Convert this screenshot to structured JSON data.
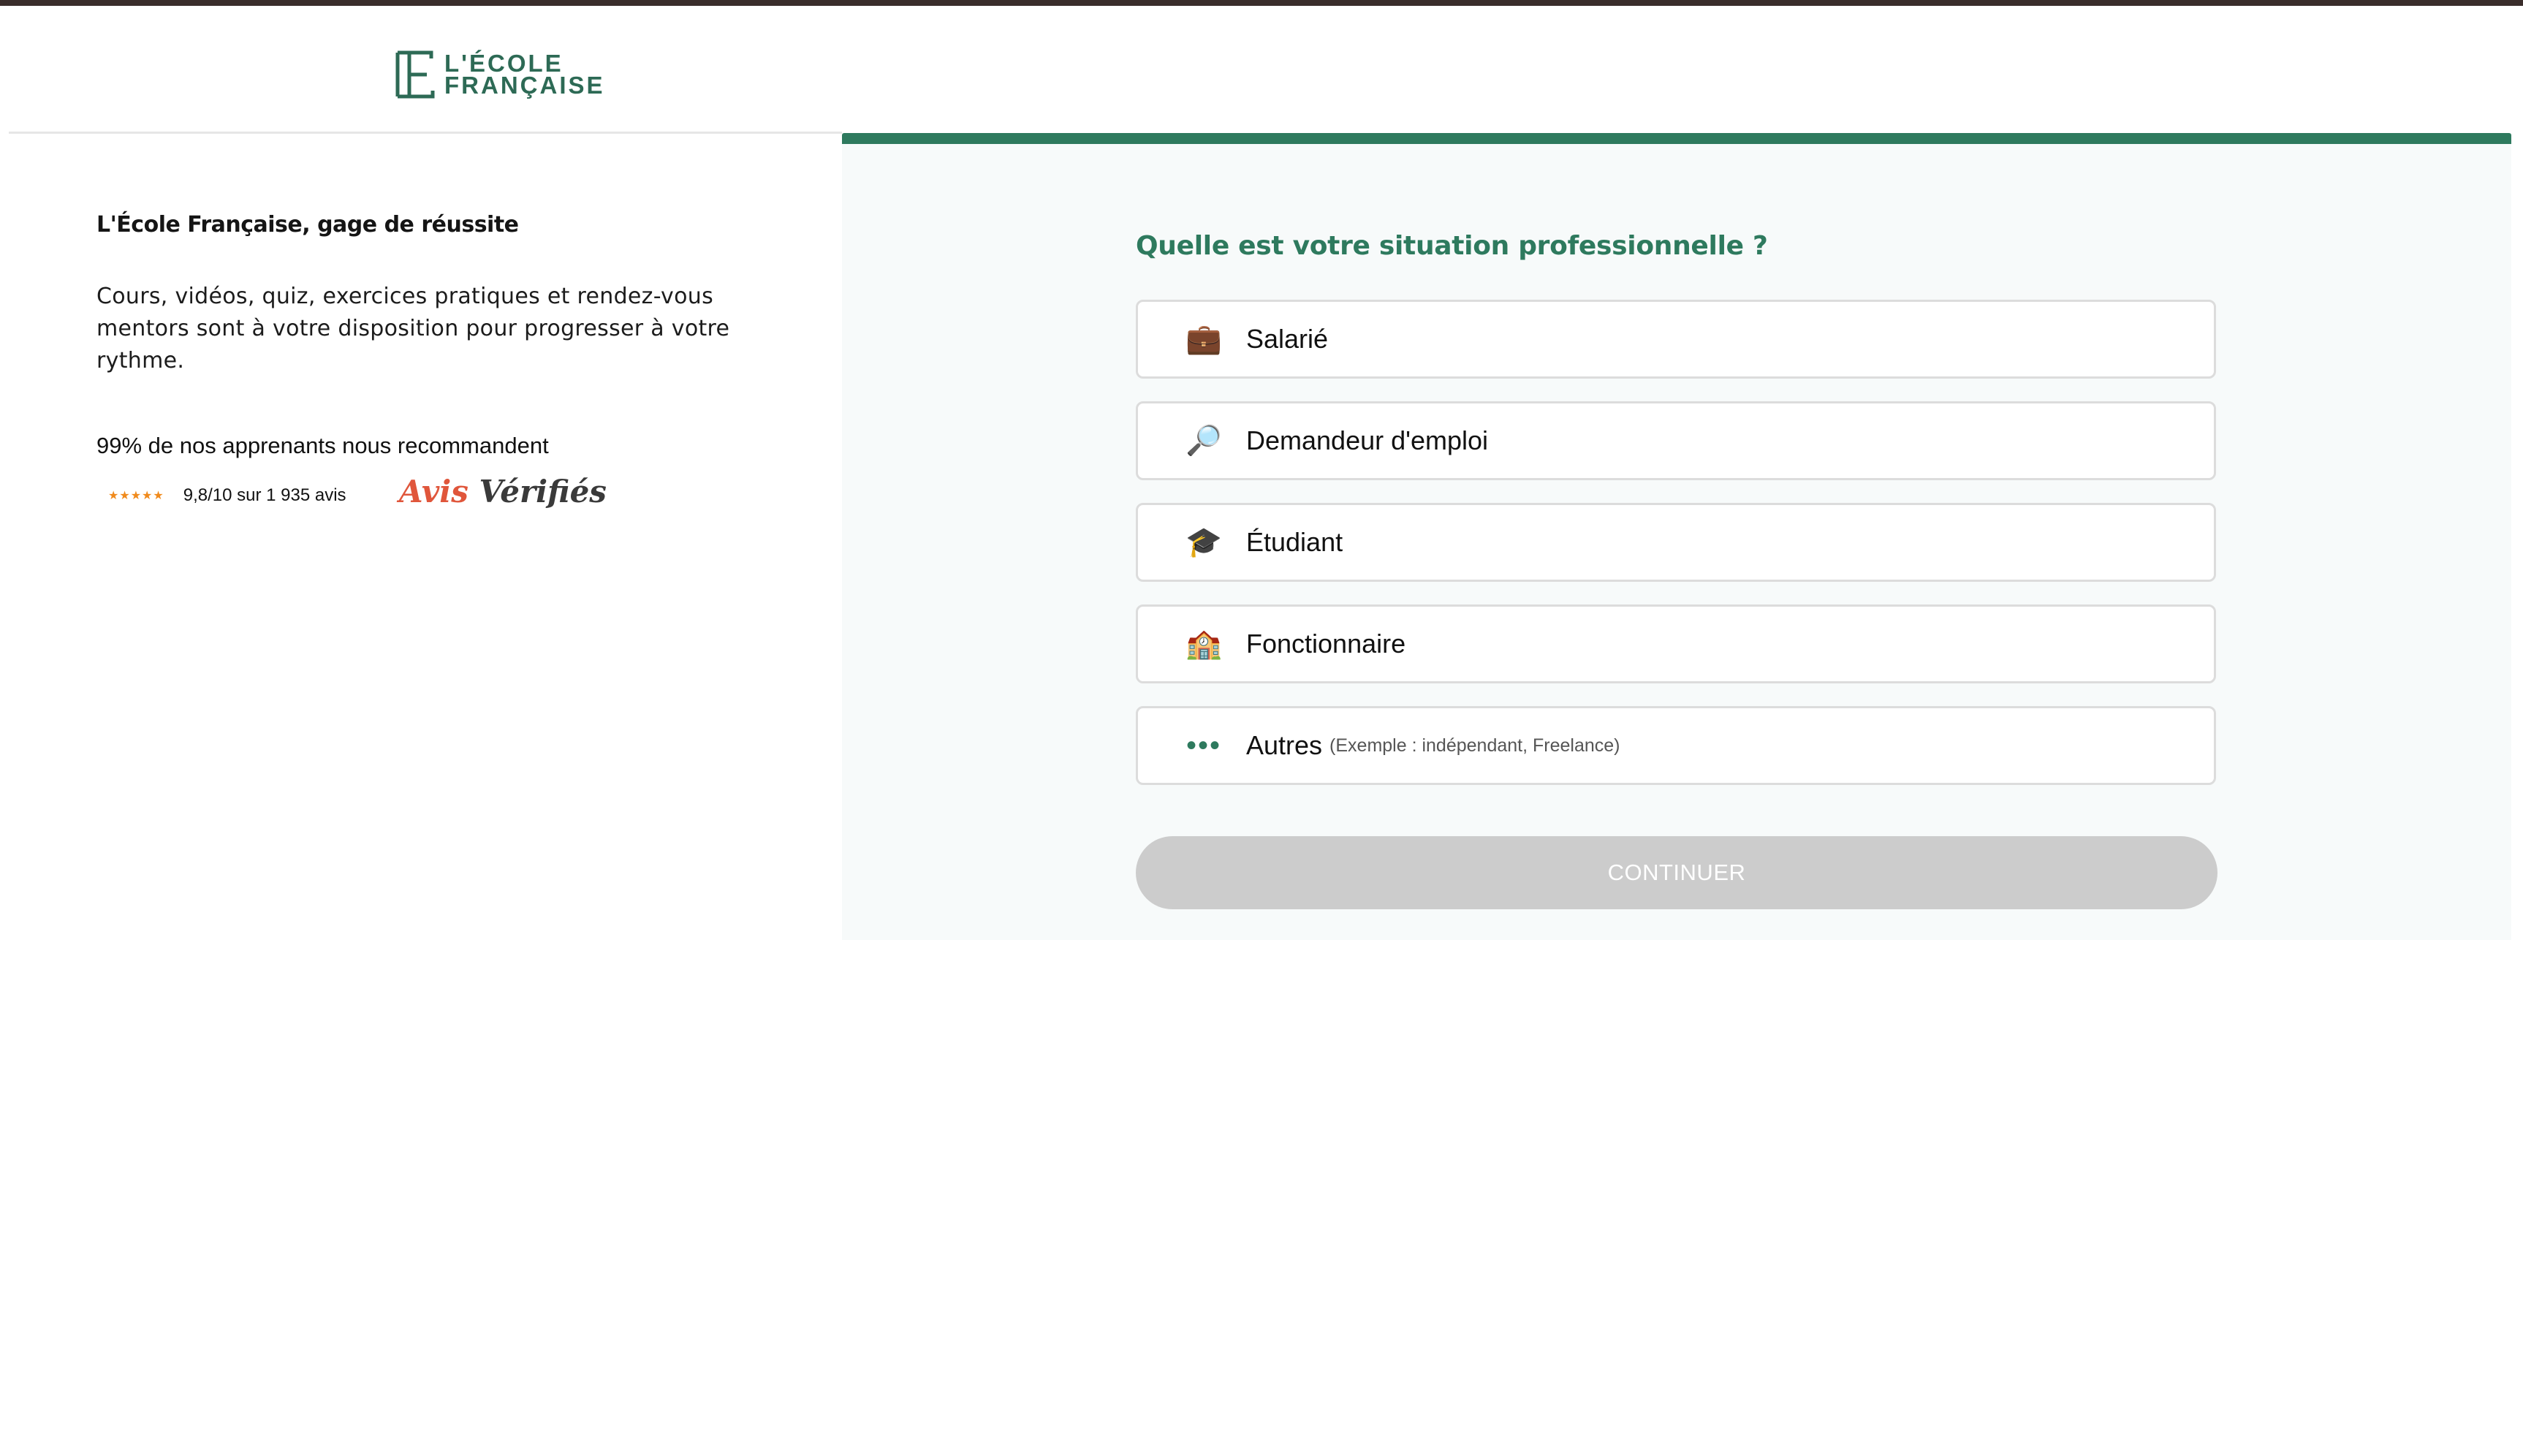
{
  "brand": {
    "line1": "L'ÉCOLE",
    "line2": "FRANÇAISE",
    "color": "#2d6a55",
    "icon": "ecole-francaise-logo-icon"
  },
  "left": {
    "title": "L'École Française, gage de réussite",
    "description": "Cours, vidéos, quiz, exercices pratiques et rendez-vous mentors sont à votre disposition pour progresser à votre rythme.",
    "recommend": "99% de nos apprenants nous recommandent",
    "stars": "★★★★★",
    "rating": "9,8/10 sur 1 935 avis",
    "avis_part1": "Avis",
    "avis_part2": "Vérifiés"
  },
  "form": {
    "question": "Quelle est votre situation professionnelle ?",
    "options": [
      {
        "label": "Salarié",
        "icon": "briefcase-icon",
        "glyph": "💼"
      },
      {
        "label": "Demandeur d'emploi",
        "icon": "magnifying-glass-icon",
        "glyph": "🔎"
      },
      {
        "label": "Étudiant",
        "icon": "graduation-cap-icon",
        "glyph": "🎓"
      },
      {
        "label": "Fonctionnaire",
        "icon": "building-icon",
        "glyph": "🏫"
      },
      {
        "label": "Autres",
        "hint": "(Exemple : indépendant, Freelance)",
        "icon": "dots-icon",
        "glyph": "•••"
      }
    ],
    "continue_label": "CONTINUER"
  },
  "colors": {
    "accent": "#2e7a5e",
    "top_strip": "#3a2d2b",
    "button_disabled": "#cccccc",
    "stars": "#f08a1c"
  }
}
